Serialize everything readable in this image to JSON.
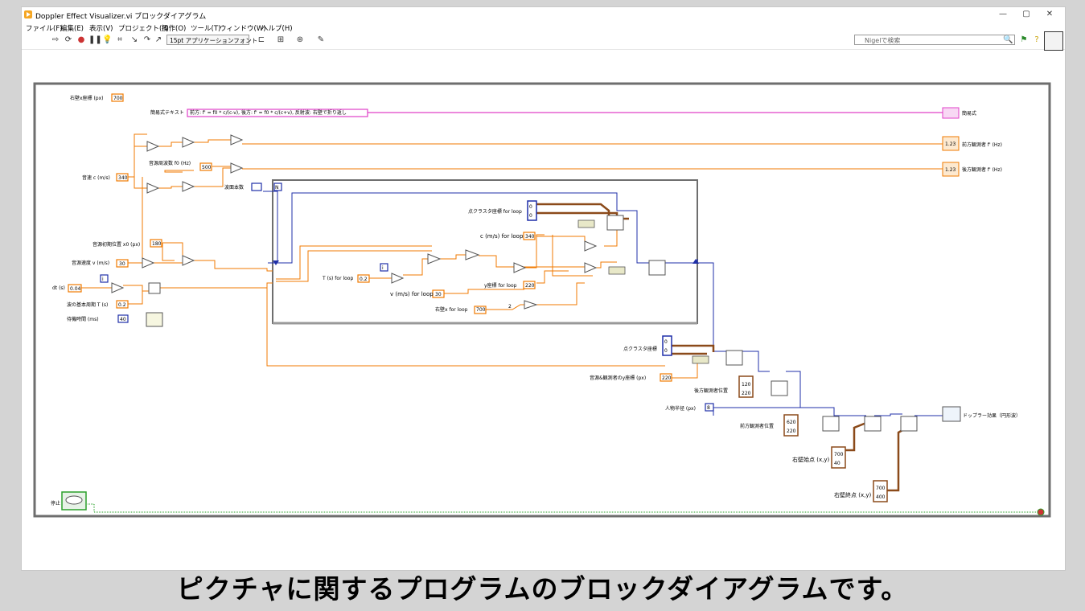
{
  "window": {
    "title": "Doppler Effect Visualizer.vi ブロックダイアグラム",
    "controls": [
      "—",
      "▢",
      "✕"
    ]
  },
  "menu": [
    "ファイル(F)",
    "編集(E)",
    "表示(V)",
    "プロジェクト(P)",
    "操作(O)",
    "ツール(T)",
    "ウィンドウ(W)",
    "ヘルプ(H)"
  ],
  "toolbar": {
    "font_select": "15pt アプリケーションフォント",
    "search_placeholder": "Nigelで検索",
    "icons": [
      "run-arrow-icon",
      "run-continuously-icon",
      "abort-icon",
      "pause-icon",
      "highlight-execution-icon",
      "retain-wire-values-icon",
      "step-into-icon",
      "step-over-icon",
      "step-out-icon",
      "align-icon",
      "distribute-icon",
      "reorder-icon",
      "cleanup-icon",
      "search-icon",
      "warning-icon",
      "help-icon"
    ]
  },
  "diagram": {
    "labels": {
      "wall_x": "右壁x座標 (px)",
      "formula_text": "簡易式テキスト",
      "sound_speed": "音速 c (m/s)",
      "source_freq": "音源周波数 f0 (Hz)",
      "wave_count": "波面本数",
      "initial_pos": "音源初期位置 x0 (px)",
      "source_speed": "音源速度 v (m/s)",
      "dt": "dt (s)",
      "period": "波の基本周期 T (s)",
      "wait_time": "待機時間 (ms)",
      "stop": "停止",
      "cluster_loop": "点クラスタ座標 for loop",
      "c_loop": "c (m/s) for loop",
      "T_loop": "T (s) for loop",
      "v_loop": "v (m/s) for loop",
      "y_loop": "y座標 for loop",
      "wall_loop": "右壁x for loop",
      "cluster": "点クラスタ座標",
      "observer_y": "音源&観測者のy座標 (px)",
      "rear_observer": "後方観測者位置",
      "person_radius": "人物半径 (px)",
      "front_observer": "前方観測者位置",
      "wall_start": "右壁始点 (x,y)",
      "wall_end": "右壁終点 (x,y)",
      "out_formula": "簡易式",
      "out_front_freq": "前方観測者 f' (Hz)",
      "out_rear_freq": "後方観測者 f' (Hz)",
      "out_picture": "ドップラー効果（円形波）"
    },
    "values": {
      "wall_x": "700",
      "formula_string": "前方: f' = f0 * c/(c-v), 後方: f' = f0 * c/(c+v), 反射波: 右壁で折り返し",
      "sound_speed": "340",
      "source_freq": "500",
      "initial_pos": "180",
      "source_speed": "30",
      "dt": "0.04",
      "period": "0.2",
      "wait_time": "40",
      "loop_c": "340",
      "loop_T": "0.2",
      "loop_v": "30",
      "loop_y": "220",
      "loop_wall": "700",
      "const_two": "2",
      "observer_y": "220",
      "cluster_a": "0",
      "cluster_b": "0",
      "rear_x": "120",
      "rear_y": "220",
      "radius": "8",
      "front_x": "620",
      "front_y": "220",
      "wall_start_x": "700",
      "wall_start_y": "40",
      "wall_end_x": "700",
      "wall_end_y": "400",
      "num_display": "1.23",
      "iter_i": "i",
      "N": "N"
    }
  },
  "caption": "ピクチャに関するプログラムのブロックダイアグラムです。",
  "colors": {
    "numeric_wire": "#f07a00",
    "integer_wire": "#1f2fa8",
    "string_wire": "#e040c8",
    "cluster_wire": "#8b4a1a",
    "boolean_wire": "#2aa02a",
    "while_border": "#6e6e6e"
  }
}
